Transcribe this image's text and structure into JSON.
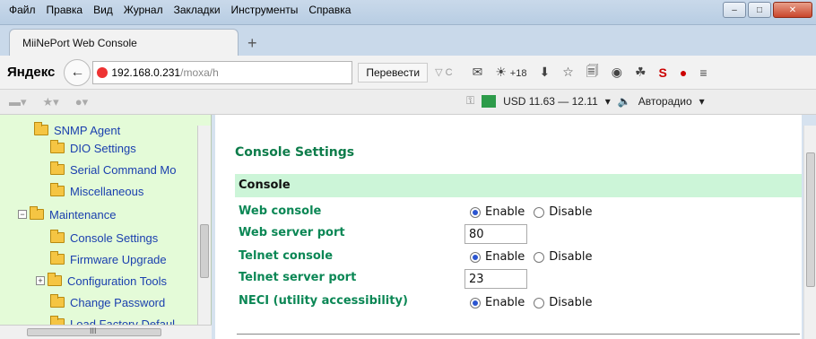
{
  "menu": [
    "Файл",
    "Правка",
    "Вид",
    "Журнал",
    "Закладки",
    "Инструменты",
    "Справка"
  ],
  "tab": {
    "title": "MiiNePort Web Console",
    "new_tab": "+"
  },
  "navbar": {
    "logo": "Яндекс",
    "url_host": "192.168.0.231",
    "url_path": "/moxa/h",
    "translate_label": "Перевести",
    "weather": "+18"
  },
  "bar2": {
    "currency": "USD 11.63 — 12.11",
    "radio": "Авторадио"
  },
  "sidebar": {
    "items": [
      {
        "label": "SNMP Agent",
        "type": "folder"
      },
      {
        "label": "DIO Settings",
        "type": "folder"
      },
      {
        "label": "Serial Command Mo",
        "type": "folder"
      },
      {
        "label": "Miscellaneous",
        "type": "folder"
      },
      {
        "label": "Maintenance",
        "type": "open-folder"
      },
      {
        "label": "Console Settings",
        "type": "folder"
      },
      {
        "label": "Firmware Upgrade",
        "type": "folder"
      },
      {
        "label": "Configuration Tools",
        "type": "folder"
      },
      {
        "label": "Change Password",
        "type": "folder"
      },
      {
        "label": "Load Factory Defaul",
        "type": "folder"
      }
    ],
    "scroll_glyph": "III"
  },
  "page": {
    "title": "Console Settings",
    "section": "Console",
    "rows": [
      {
        "label": "Web console",
        "kind": "radio",
        "selected": "Enable"
      },
      {
        "label": "Web server port",
        "kind": "input",
        "value": "80"
      },
      {
        "label": "Telnet console",
        "kind": "radio",
        "selected": "Enable"
      },
      {
        "label": "Telnet server port",
        "kind": "input",
        "value": "23"
      },
      {
        "label": "NECI (utility accessibility)",
        "kind": "radio",
        "selected": "Enable"
      }
    ],
    "enable_label": "Enable",
    "disable_label": "Disable"
  }
}
